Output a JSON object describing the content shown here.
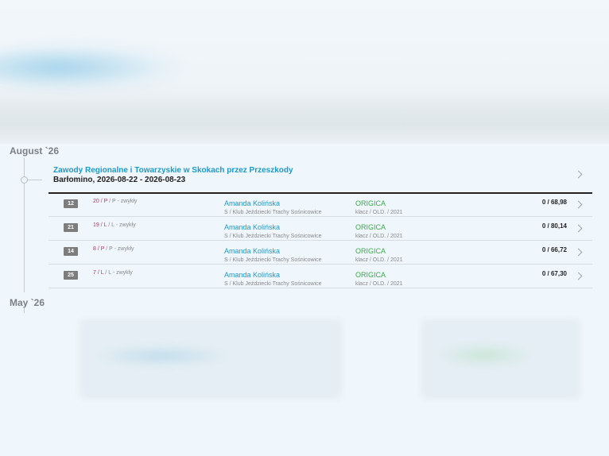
{
  "timeline": {
    "month_1": "August `26",
    "month_2": "May `26"
  },
  "event": {
    "title": "Zawody Regionalne i Towarzyskie w Skokach przez Przeszkody",
    "location_dates": "Barłomino, 2026-08-22 - 2026-08-23"
  },
  "results": [
    {
      "place": "12",
      "number": "20",
      "level": "P",
      "class": "P - zwykły",
      "rider": "Amanda Kolińska",
      "club": "S / Klub Jeździecki Trachy Sośnicowice",
      "horse": "ORIGICA",
      "horse_info": "klacz / OLD. / 2021",
      "result": "0 / 68,98"
    },
    {
      "place": "21",
      "number": "19",
      "level": "L",
      "class": "L - zwykły",
      "rider": "Amanda Kolińska",
      "club": "S / Klub Jeździecki Trachy Sośnicowice",
      "horse": "ORIGICA",
      "horse_info": "klacz / OLD. / 2021",
      "result": "0 / 80,14"
    },
    {
      "place": "14",
      "number": "8",
      "level": "P",
      "class": "P - zwykły",
      "rider": "Amanda Kolińska",
      "club": "S / Klub Jeździecki Trachy Sośnicowice",
      "horse": "ORIGICA",
      "horse_info": "klacz / OLD. / 2021",
      "result": "0 / 66,72"
    },
    {
      "place": "25",
      "number": "7",
      "level": "L",
      "class": "L - zwykły",
      "rider": "Amanda Kolińska",
      "club": "S / Klub Jeździecki Trachy Sośnicowice",
      "horse": "ORIGICA",
      "horse_info": "klacz / OLD. / 2021",
      "result": "0 / 67,30"
    }
  ],
  "icons": {
    "row_action": "chevron-right-icon",
    "event_action": "chevron-right-icon",
    "timeline_node": "circle-icon"
  },
  "colors": {
    "link_blue": "#1b9ac9",
    "horse_green": "#3aa84a",
    "level_red": "#c0305a",
    "badge_gray": "#7d7d7d"
  }
}
